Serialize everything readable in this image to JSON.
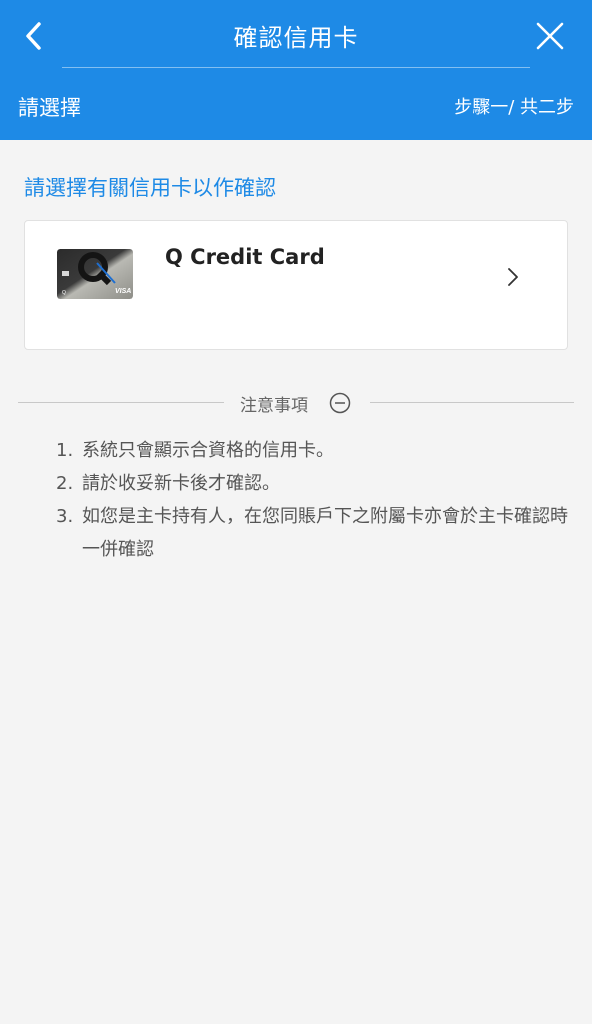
{
  "header": {
    "title": "確認信用卡",
    "back_icon": "chevron-left-icon",
    "close_icon": "close-icon",
    "subtitle_left": "請選擇",
    "subtitle_right": "步驟一/ 共二步",
    "background": "#1e8ae6"
  },
  "main": {
    "prompt": "請選擇有關信用卡以作確認",
    "cards": [
      {
        "name": "Q Credit Card",
        "card_logo_text": "VISA",
        "chevron_icon": "chevron-right-icon"
      }
    ]
  },
  "notice": {
    "title": "注意事項",
    "toggle_icon": "minus-circle-icon",
    "items": [
      {
        "num": "1.",
        "text": "系統只會顯示合資格的信用卡。"
      },
      {
        "num": "2.",
        "text": "請於收妥新卡後才確認。"
      },
      {
        "num": "3.",
        "text": "如您是主卡持有人，在您同賬戶下之附屬卡亦會於主卡確認時一併確認"
      }
    ]
  },
  "colors": {
    "accent": "#1e8ae6",
    "page_bg": "#f4f4f4"
  }
}
